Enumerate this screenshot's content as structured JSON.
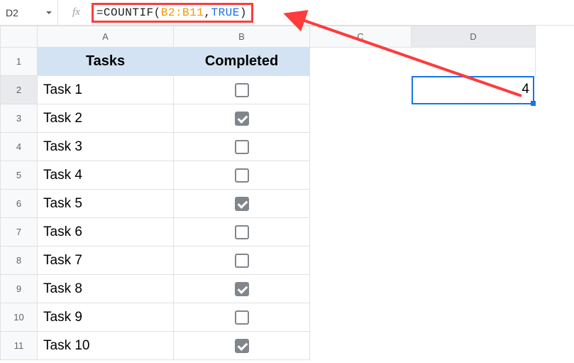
{
  "formula_bar": {
    "cell_ref": "D2",
    "fx_label": "fx",
    "formula_prefix": "=COUNTIF(",
    "formula_range": "B2:B11",
    "formula_sep": ",",
    "formula_bool": "TRUE",
    "formula_suffix": ")"
  },
  "columns": [
    "A",
    "B",
    "C",
    "D"
  ],
  "row_numbers": [
    "1",
    "2",
    "3",
    "4",
    "5",
    "6",
    "7",
    "8",
    "9",
    "10",
    "11"
  ],
  "headers": {
    "tasks": "Tasks",
    "completed": "Completed"
  },
  "rows": [
    {
      "task": "Task 1",
      "done": false
    },
    {
      "task": "Task 2",
      "done": true
    },
    {
      "task": "Task 3",
      "done": false
    },
    {
      "task": "Task 4",
      "done": false
    },
    {
      "task": "Task 5",
      "done": true
    },
    {
      "task": "Task 6",
      "done": false
    },
    {
      "task": "Task 7",
      "done": false
    },
    {
      "task": "Task 8",
      "done": true
    },
    {
      "task": "Task 9",
      "done": false
    },
    {
      "task": "Task 10",
      "done": true
    }
  ],
  "selected_cell": {
    "ref": "D2",
    "value": "4"
  },
  "chart_data": {
    "type": "table",
    "title": "Task completion checklist with COUNTIF of TRUE values in D2",
    "columns": [
      "Tasks",
      "Completed"
    ],
    "rows": [
      [
        "Task 1",
        false
      ],
      [
        "Task 2",
        true
      ],
      [
        "Task 3",
        false
      ],
      [
        "Task 4",
        false
      ],
      [
        "Task 5",
        true
      ],
      [
        "Task 6",
        false
      ],
      [
        "Task 7",
        false
      ],
      [
        "Task 8",
        true
      ],
      [
        "Task 9",
        false
      ],
      [
        "Task 10",
        true
      ]
    ],
    "d2_formula": "=COUNTIF(B2:B11,TRUE)",
    "d2_value": 4
  }
}
